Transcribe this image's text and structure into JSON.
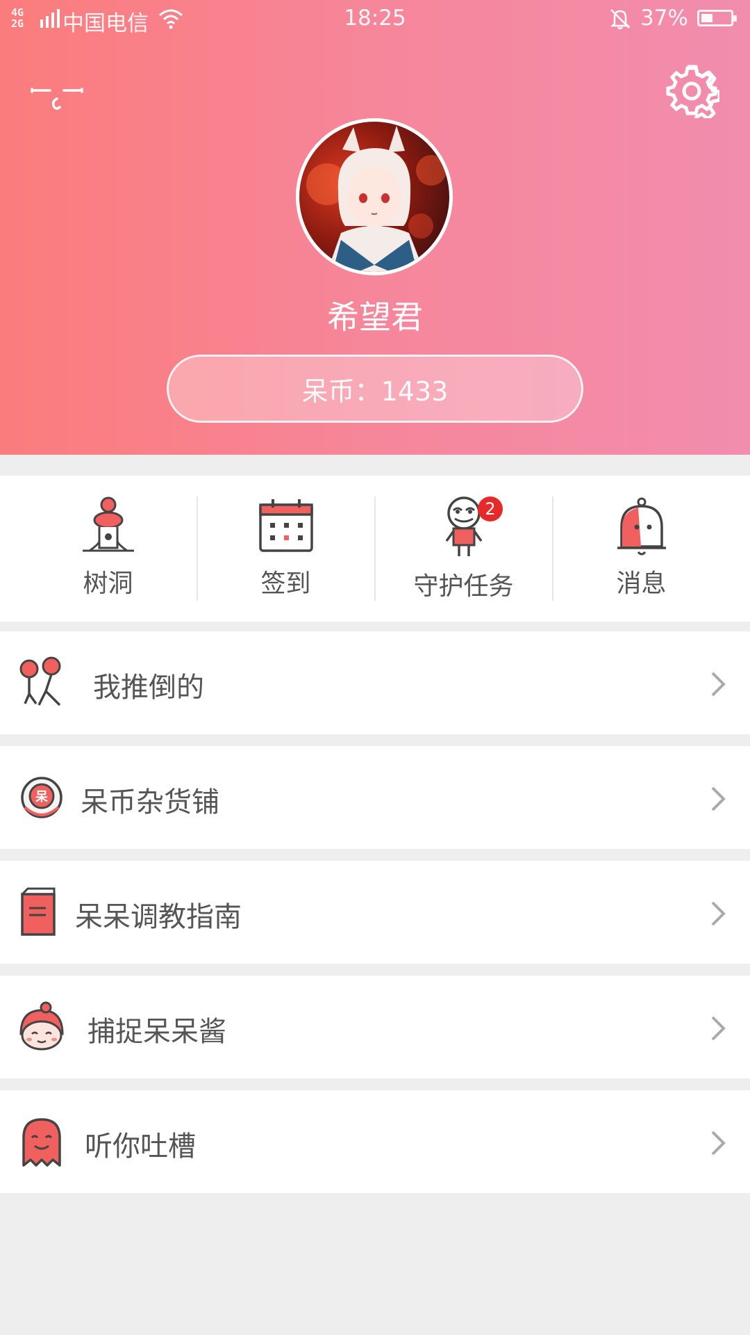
{
  "status_bar": {
    "network": "4G\n2G",
    "carrier": "中国电信",
    "time": "18:25",
    "battery": "37%"
  },
  "profile": {
    "username": "希望君",
    "coins_label": "呆币：1433"
  },
  "quick_actions": [
    {
      "label": "树洞",
      "icon": "tree-hole-icon"
    },
    {
      "label": "签到",
      "icon": "calendar-icon"
    },
    {
      "label": "守护任务",
      "icon": "guardian-task-icon",
      "badge": "2"
    },
    {
      "label": "消息",
      "icon": "bell-icon"
    }
  ],
  "menu": [
    {
      "label": "我推倒的",
      "icon": "pushed-down-icon"
    },
    {
      "label": "呆币杂货铺",
      "icon": "coin-shop-icon"
    },
    {
      "label": "呆呆调教指南",
      "icon": "guide-book-icon"
    },
    {
      "label": "捕捉呆呆酱",
      "icon": "catch-girl-icon"
    },
    {
      "label": "听你吐槽",
      "icon": "ghost-icon"
    }
  ],
  "colors": {
    "header_start": "#fb7c7c",
    "header_end": "#f28dae",
    "accent": "#f0605e",
    "badge": "#e62a2a"
  }
}
